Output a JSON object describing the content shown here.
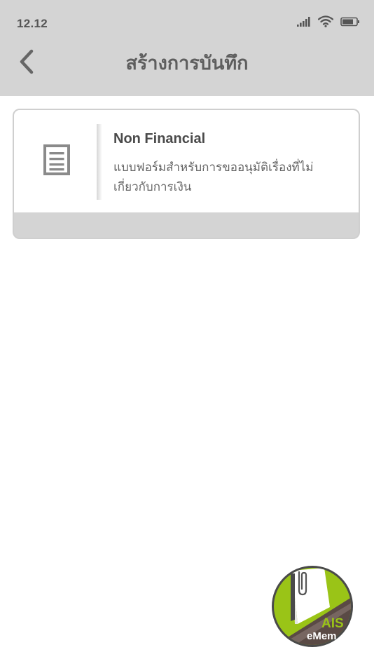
{
  "status_bar": {
    "time": "12.12"
  },
  "header": {
    "title": "สร้างการบันทึก",
    "back_icon": "chevron-left-icon"
  },
  "card": {
    "icon": "document-icon",
    "title": "Non Financial",
    "description": "แบบฟอร์มสำหรับการขออนุมัติเรื่องที่ไม่เกี่ยวกับการเงิน"
  },
  "fab": {
    "brand": "AIS",
    "product": "eMem"
  },
  "colors": {
    "header_bg": "#d4d4d4",
    "text_dark": "#4a4a4a",
    "text_muted": "#666666",
    "brand_green": "#9ac417"
  }
}
